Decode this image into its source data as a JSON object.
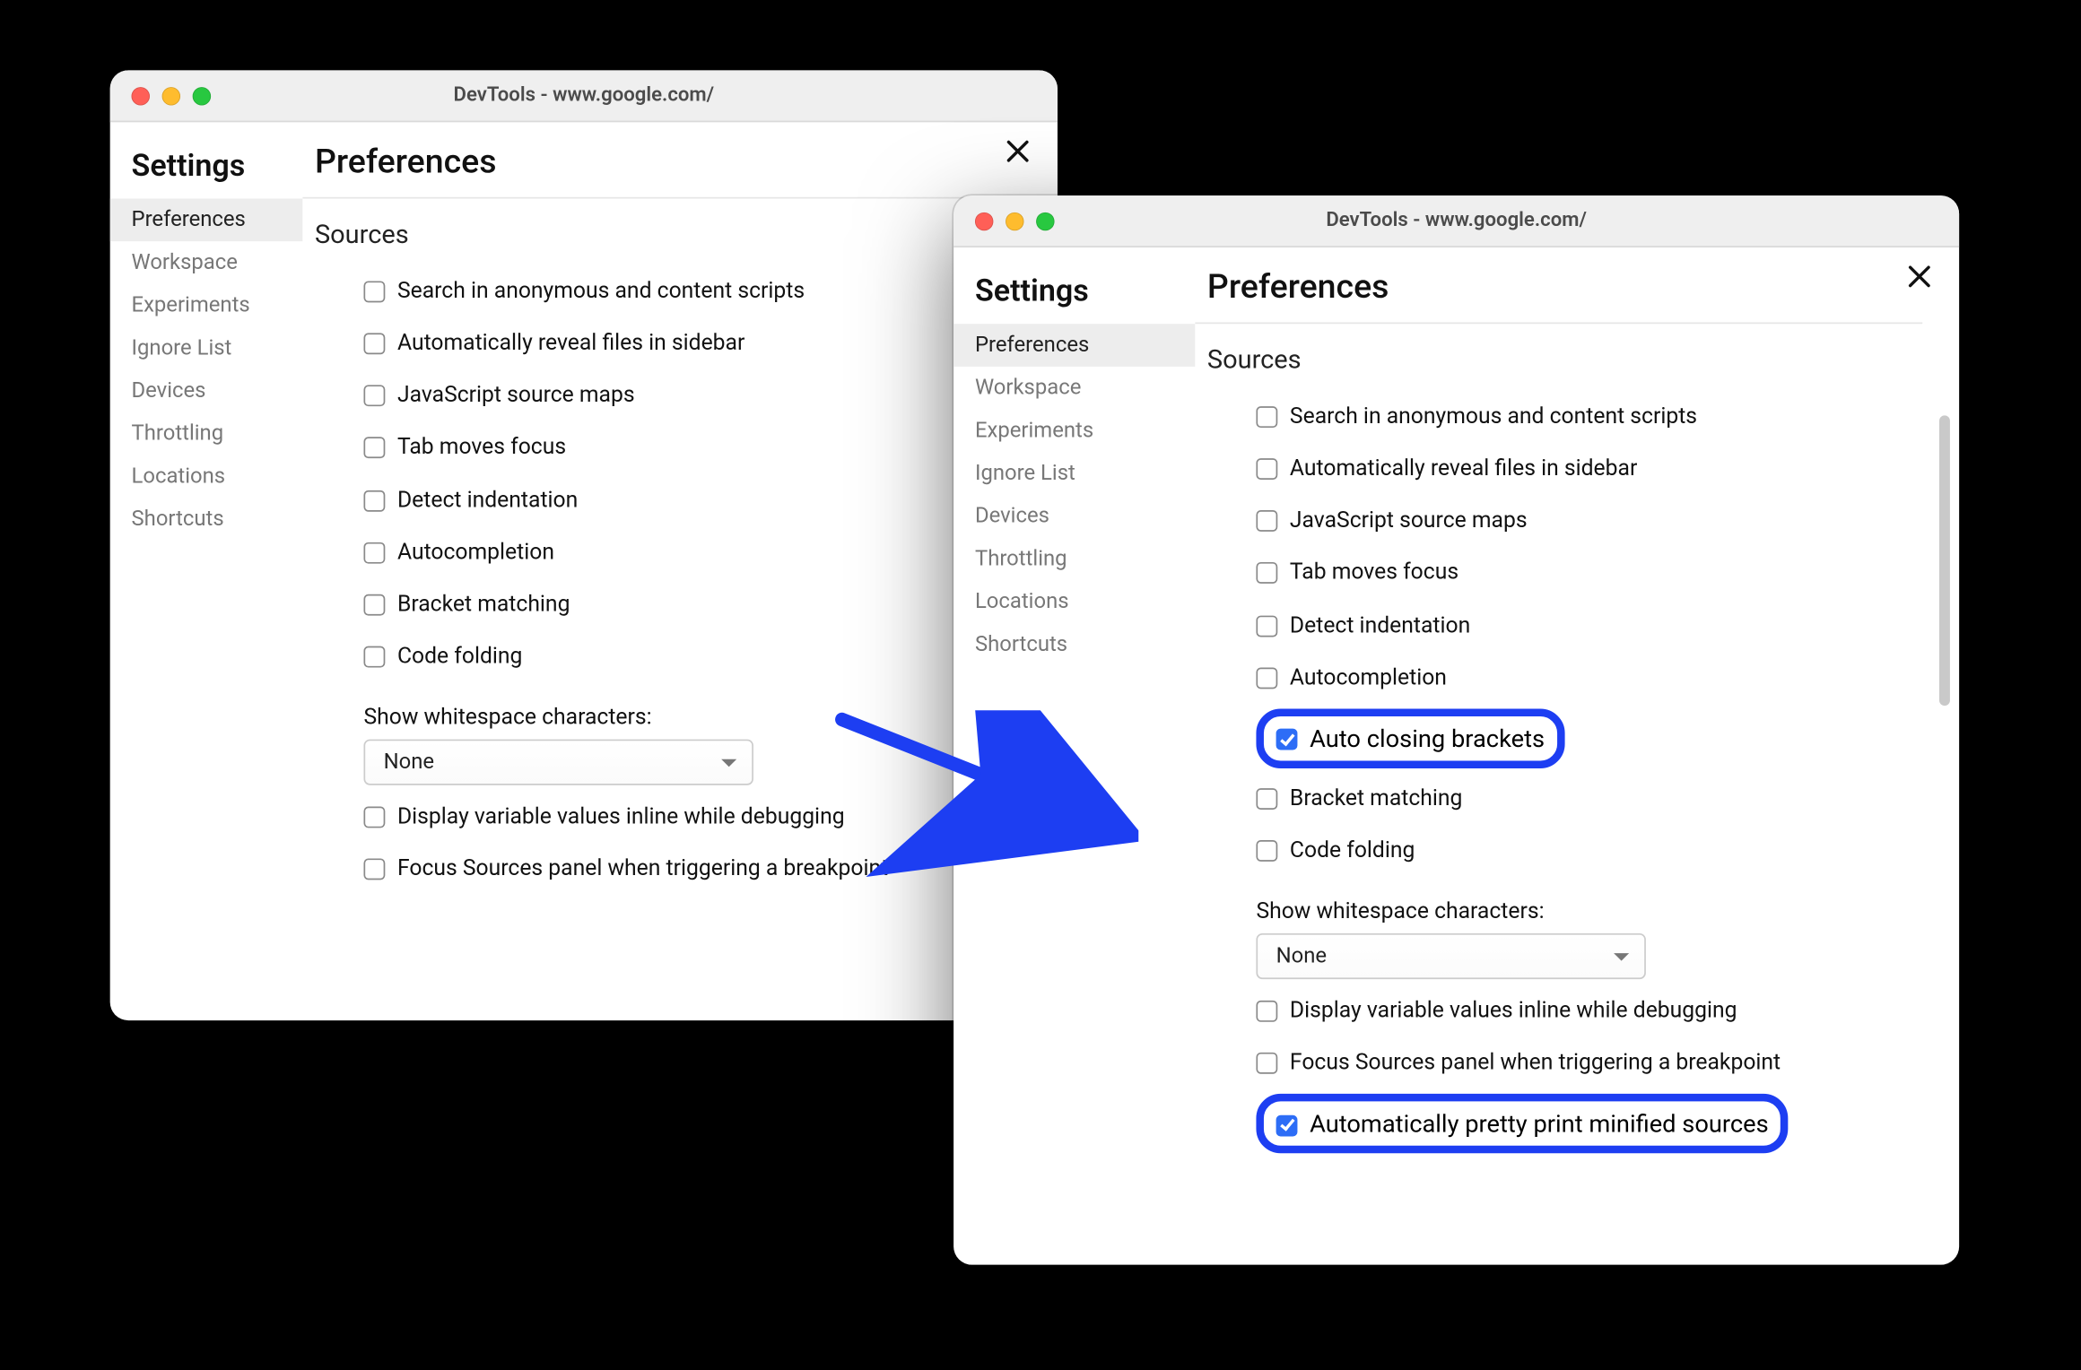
{
  "colors": {
    "accent": "#1d3ef2",
    "checkbox_checked": "#2d6df6"
  },
  "window1": {
    "title": "DevTools - www.google.com/",
    "settings_heading": "Settings",
    "nav": [
      "Preferences",
      "Workspace",
      "Experiments",
      "Ignore List",
      "Devices",
      "Throttling",
      "Locations",
      "Shortcuts"
    ],
    "selected_nav_index": 0,
    "main_title": "Preferences",
    "section_title": "Sources",
    "options": [
      {
        "label": "Search in anonymous and content scripts",
        "checked": false
      },
      {
        "label": "Automatically reveal files in sidebar",
        "checked": false
      },
      {
        "label": "JavaScript source maps",
        "checked": false
      },
      {
        "label": "Tab moves focus",
        "checked": false
      },
      {
        "label": "Detect indentation",
        "checked": false
      },
      {
        "label": "Autocompletion",
        "checked": false
      },
      {
        "label": "Bracket matching",
        "checked": false
      },
      {
        "label": "Code folding",
        "checked": false
      }
    ],
    "whitespace_label": "Show whitespace characters:",
    "whitespace_value": "None",
    "options_tail": [
      {
        "label": "Display variable values inline while debugging",
        "checked": false
      },
      {
        "label": "Focus Sources panel when triggering a breakpoint",
        "checked": false
      }
    ]
  },
  "window2": {
    "title": "DevTools - www.google.com/",
    "settings_heading": "Settings",
    "nav": [
      "Preferences",
      "Workspace",
      "Experiments",
      "Ignore List",
      "Devices",
      "Throttling",
      "Locations",
      "Shortcuts"
    ],
    "selected_nav_index": 0,
    "main_title": "Preferences",
    "section_title": "Sources",
    "options": [
      {
        "label": "Search in anonymous and content scripts",
        "checked": false,
        "highlight": false
      },
      {
        "label": "Automatically reveal files in sidebar",
        "checked": false,
        "highlight": false
      },
      {
        "label": "JavaScript source maps",
        "checked": false,
        "highlight": false
      },
      {
        "label": "Tab moves focus",
        "checked": false,
        "highlight": false
      },
      {
        "label": "Detect indentation",
        "checked": false,
        "highlight": false
      },
      {
        "label": "Autocompletion",
        "checked": false,
        "highlight": false
      },
      {
        "label": "Auto closing brackets",
        "checked": true,
        "highlight": true
      },
      {
        "label": "Bracket matching",
        "checked": false,
        "highlight": false
      },
      {
        "label": "Code folding",
        "checked": false,
        "highlight": false
      }
    ],
    "whitespace_label": "Show whitespace characters:",
    "whitespace_value": "None",
    "options_tail": [
      {
        "label": "Display variable values inline while debugging",
        "checked": false,
        "highlight": false
      },
      {
        "label": "Focus Sources panel when triggering a breakpoint",
        "checked": false,
        "highlight": false
      },
      {
        "label": "Automatically pretty print minified sources",
        "checked": true,
        "highlight": true
      }
    ]
  }
}
